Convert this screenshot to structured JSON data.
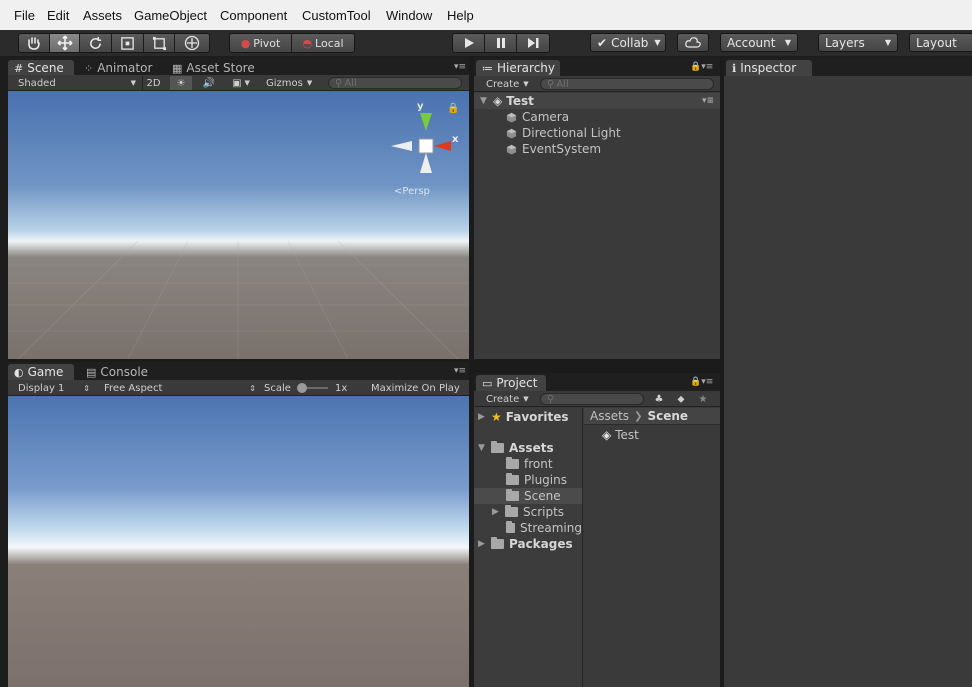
{
  "menu": [
    "File",
    "Edit",
    "Assets",
    "GameObject",
    "Component",
    "CustomTool",
    "Window",
    "Help"
  ],
  "toolbar": {
    "pivot": "Pivot",
    "local": "Local",
    "collab": "Collab",
    "account": "Account",
    "layers": "Layers",
    "layout": "Layout"
  },
  "scene_panel": {
    "tabs": [
      "Scene",
      "Animator",
      "Asset Store"
    ],
    "shading": "Shaded",
    "mode_2d": "2D",
    "gizmos": "Gizmos",
    "search_placeholder": "All",
    "gizmo_y": "y",
    "gizmo_x": "x",
    "persp": "Persp"
  },
  "game_panel": {
    "tabs": [
      "Game",
      "Console"
    ],
    "display": "Display 1",
    "aspect": "Free Aspect",
    "scale_label": "Scale",
    "scale_value": "1x",
    "maximize": "Maximize On Play"
  },
  "hierarchy": {
    "tab": "Hierarchy",
    "create": "Create",
    "search_placeholder": "All",
    "scene": "Test",
    "items": [
      "Camera",
      "Directional Light",
      "EventSystem"
    ]
  },
  "project": {
    "tab": "Project",
    "create": "Create",
    "favorites": "Favorites",
    "assets": "Assets",
    "folders": [
      "front",
      "Plugins",
      "Scene",
      "Scripts",
      "Streaming"
    ],
    "packages": "Packages",
    "breadcrumb": [
      "Assets",
      "Scene"
    ],
    "files": [
      "Test"
    ]
  },
  "inspector": {
    "tab": "Inspector"
  },
  "colors": {
    "menubar": "#f0f0f0",
    "panel_bg": "#3a3a3a",
    "gizmo_y": "#7ac943",
    "gizmo_x": "#e0391e"
  }
}
